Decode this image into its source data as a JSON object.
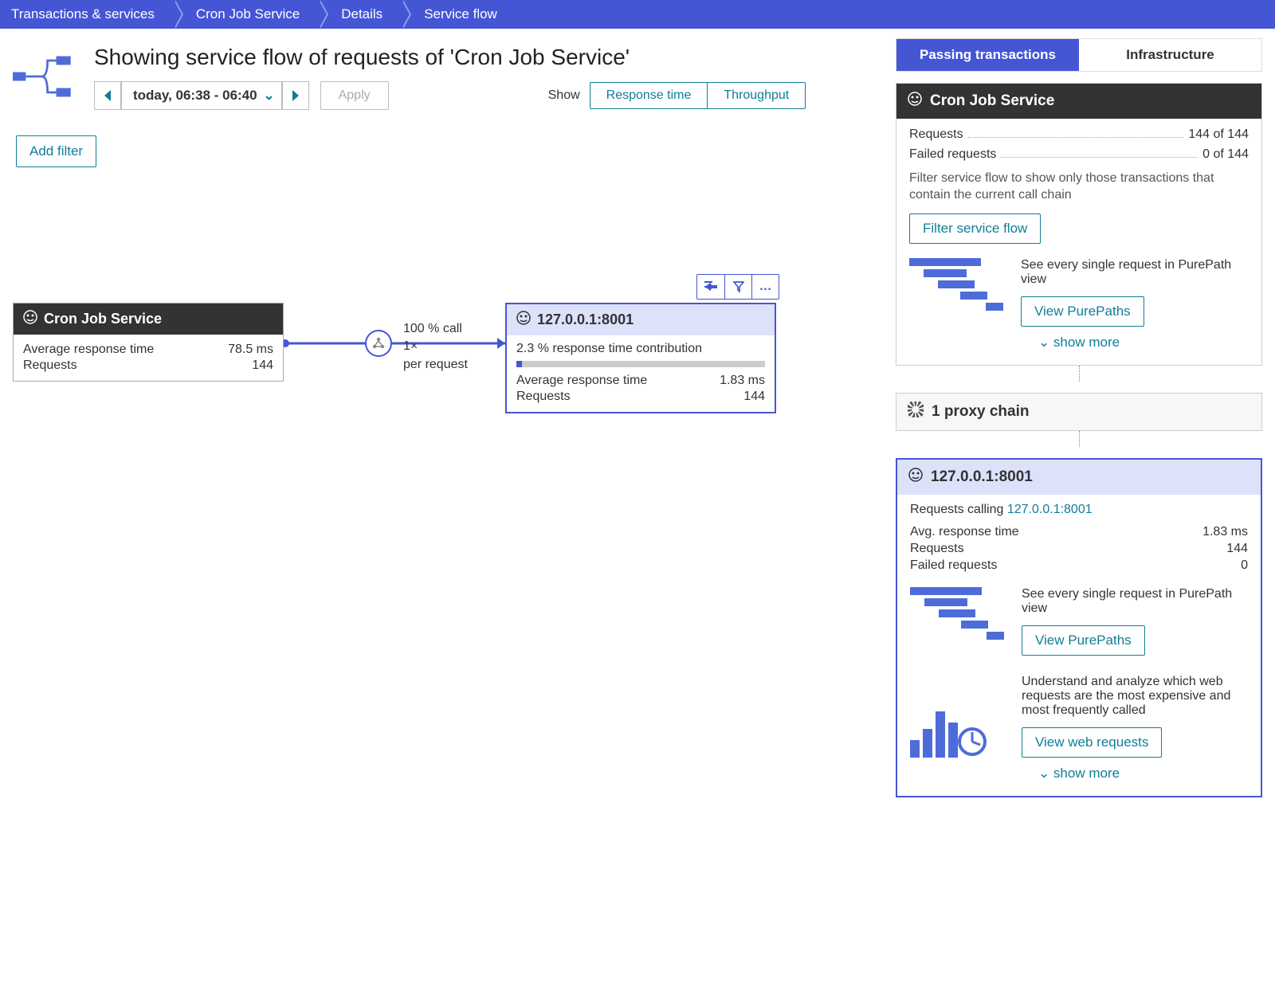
{
  "breadcrumbs": [
    "Transactions & services",
    "Cron Job Service",
    "Details",
    "Service flow"
  ],
  "title": "Showing service flow of requests of 'Cron Job Service'",
  "time_range": "today, 06:38 - 06:40",
  "apply": "Apply",
  "add_filter": "Add filter",
  "show_label": "Show",
  "toggle": {
    "a": "Response time",
    "b": "Throughput"
  },
  "flow": {
    "source": {
      "name": "Cron Job Service",
      "art_label": "Average response time",
      "art_value": "78.5 ms",
      "req_label": "Requests",
      "req_value": "144"
    },
    "edge": {
      "call": "100 % call",
      "times": "1×",
      "per": "per request"
    },
    "target": {
      "name": "127.0.0.1:8001",
      "contrib": "2.3 % response time contribution",
      "art_label": "Average response time",
      "art_value": "1.83 ms",
      "req_label": "Requests",
      "req_value": "144"
    }
  },
  "right": {
    "tabs": {
      "a": "Passing transactions",
      "b": "Infrastructure"
    },
    "card1": {
      "title": "Cron Job Service",
      "requests_label": "Requests",
      "requests_value": "144 of 144",
      "failed_label": "Failed requests",
      "failed_value": "0 of 144",
      "filter_hint": "Filter service flow to show only those transactions that contain the current call chain",
      "filter_btn": "Filter service flow",
      "pp_text": "See every single request in PurePath view",
      "pp_btn": "View PurePaths",
      "show_more": "show more"
    },
    "proxy": "1 proxy chain",
    "card2": {
      "title": "127.0.0.1:8001",
      "calling_label": "Requests calling",
      "calling_target": "127.0.0.1:8001",
      "art_label": "Avg. response time",
      "art_value": "1.83 ms",
      "req_label": "Requests",
      "req_value": "144",
      "failed_label": "Failed requests",
      "failed_value": "0",
      "pp_text": "See every single request in PurePath view",
      "pp_btn": "View PurePaths",
      "web_text": "Understand and analyze which web requests are the most expensive and most frequently called",
      "web_btn": "View web requests",
      "show_more": "show more"
    }
  }
}
